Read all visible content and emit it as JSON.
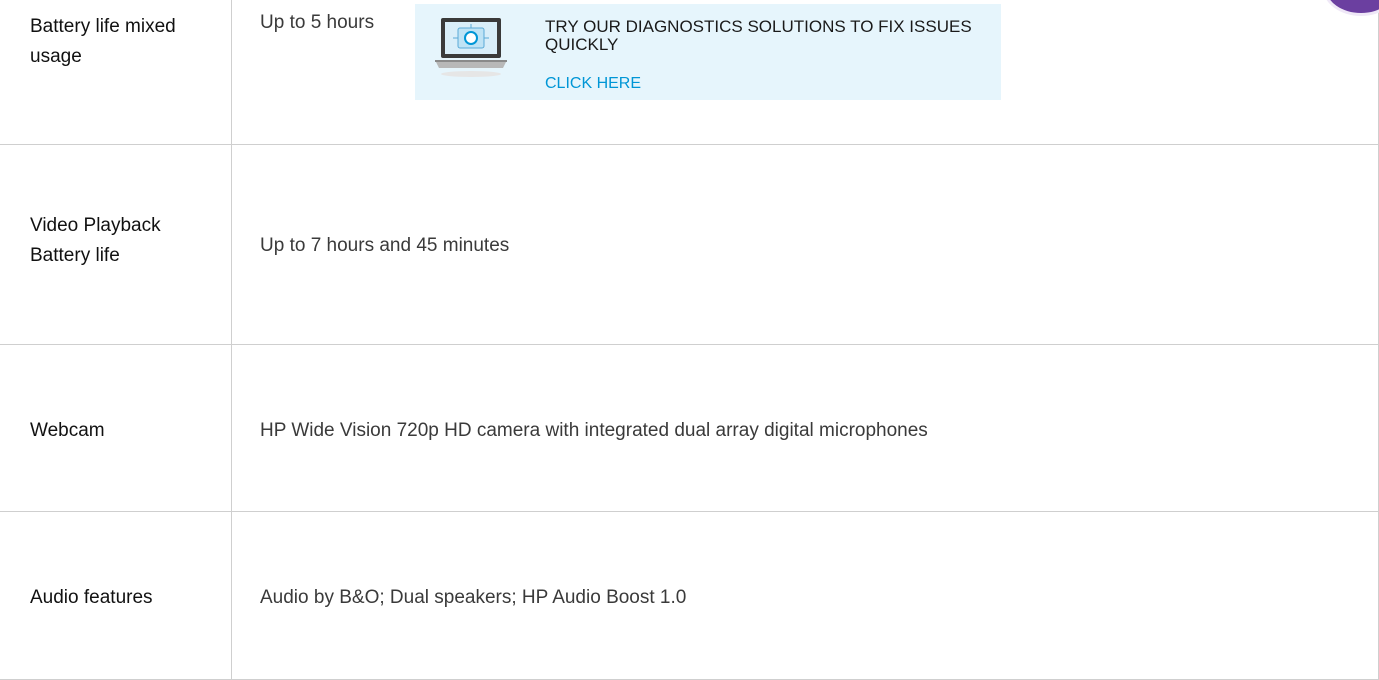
{
  "specs": [
    {
      "label": "Battery life mixed usage",
      "value": "Up to 5 hours"
    },
    {
      "label": "Video Playback Battery life",
      "value": "Up to 7 hours and 45 minutes"
    },
    {
      "label": "Webcam",
      "value": "HP Wide Vision 720p HD camera with integrated dual array digital microphones"
    },
    {
      "label": "Audio features",
      "value": "Audio by B&O; Dual speakers; HP Audio Boost 1.0"
    }
  ],
  "promo": {
    "headline": "TRY OUR DIAGNOSTICS SOLUTIONS TO FIX ISSUES QUICKLY",
    "link": "CLICK HERE",
    "icon": "laptop-icon"
  },
  "colors": {
    "promo_bg": "#e6f5fc",
    "link": "#0096d6",
    "border": "#cfcfcf",
    "badge": "#6b3fa0"
  }
}
